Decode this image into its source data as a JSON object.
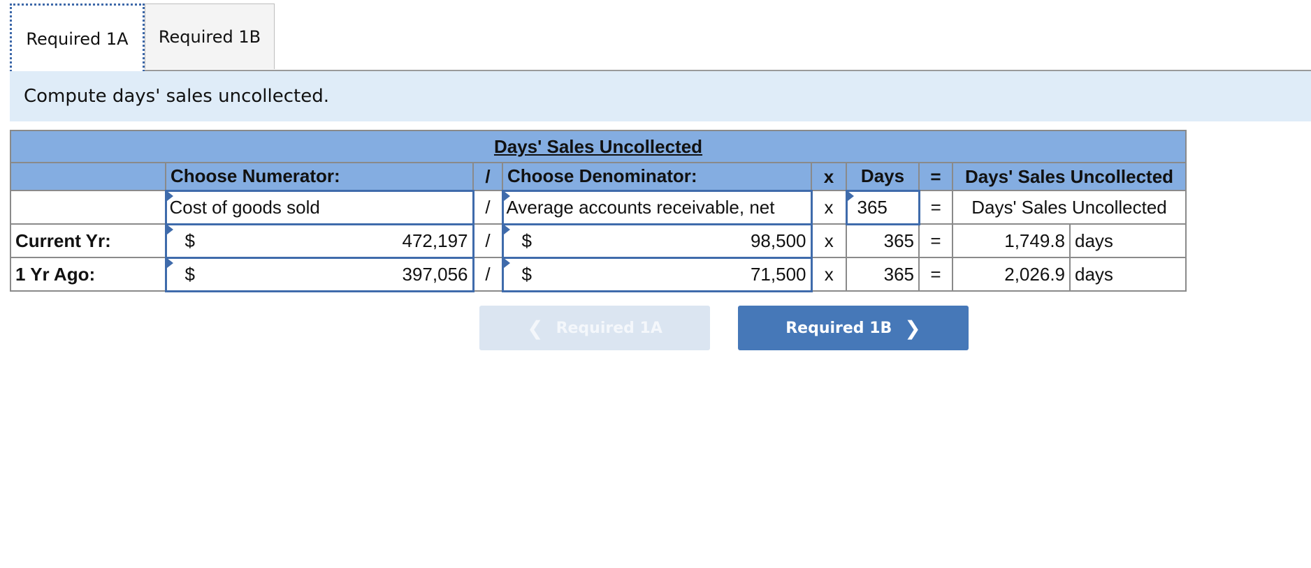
{
  "tabs": [
    {
      "label": "Required 1A",
      "active": true
    },
    {
      "label": "Required 1B",
      "active": false
    }
  ],
  "instruction": "Compute days' sales uncollected.",
  "table": {
    "title": "Days' Sales Uncollected",
    "header": {
      "numerator": "Choose Numerator:",
      "div": "/",
      "denominator": "Choose Denominator:",
      "times": "x",
      "days": "Days",
      "eq": "=",
      "result": "Days' Sales Uncollected"
    },
    "formula": {
      "numerator": "Cost of goods sold",
      "div": "/",
      "denominator": "Average accounts receivable, net",
      "times": "x",
      "days": "365",
      "eq": "=",
      "result": "Days' Sales Uncollected"
    },
    "rows": [
      {
        "label": "Current Yr:",
        "num_cur": "$",
        "numerator": "472,197",
        "div": "/",
        "den_cur": "$",
        "denominator": "98,500",
        "times": "x",
        "days": "365",
        "eq": "=",
        "result": "1,749.8",
        "unit": "days"
      },
      {
        "label": "1 Yr Ago:",
        "num_cur": "$",
        "numerator": "397,056",
        "div": "/",
        "den_cur": "$",
        "denominator": "71,500",
        "times": "x",
        "days": "365",
        "eq": "=",
        "result": "2,026.9",
        "unit": "days"
      }
    ]
  },
  "nav": {
    "prev_label": "Required 1A",
    "next_label": "Required 1B",
    "prev_icon": "chevron-left-icon",
    "next_icon": "chevron-right-icon"
  },
  "colors": {
    "header_bg": "#84ade1",
    "banner_bg": "#dfecf8",
    "input_border": "#3f6bab",
    "next_button": "#4678b8",
    "prev_button_disabled": "#dbe5f1"
  }
}
